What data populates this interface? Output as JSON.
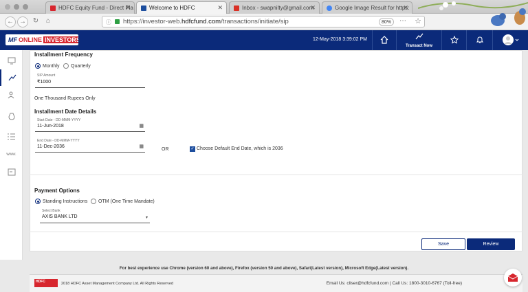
{
  "browser": {
    "tabs": [
      {
        "label": "HDFC Equity Fund - Direct Pla",
        "color": "#d7262e"
      },
      {
        "label": "Welcome to HDFC",
        "color": "#1d4e9e"
      },
      {
        "label": "Inbox - swapnilty@gmail.com",
        "color": "#d93025"
      },
      {
        "label": "Google Image Result for https:",
        "color": "#4285f4"
      }
    ],
    "url_prefix": "https://investor-web.",
    "url_domain": "hdfcfund.com",
    "url_path": "/transactions/initiate/sip",
    "zoom": "80%"
  },
  "header": {
    "logo_mf": "MF",
    "logo_online": "ONLINE",
    "logo_investors": "INVESTORS",
    "datetime": "12-May-2018 3:39:02 PM",
    "transact_label": "Transact Now"
  },
  "sidebar": {
    "www_label": "www."
  },
  "form": {
    "installment_frequency": "Installment Frequency",
    "freq_monthly": "Monthly",
    "freq_quarterly": "Quarterly",
    "sip_amount_label": "SIP Amount",
    "sip_amount_value": "₹1000",
    "amount_in_words": "One Thousand Rupees Only",
    "installment_date_details": "Installment Date Details",
    "start_date_label": "Start Date - DD-MMM-YYYY",
    "start_date_value": "11-Jun-2018",
    "end_date_label": "End Date - DD-MMM-YYYY",
    "end_date_value": "11-Dec-2036",
    "or_label": "OR",
    "default_end_date_label": "Choose Default End Date, which is 2036",
    "payment_options": "Payment Options",
    "pay_standing": "Standing Instructions",
    "pay_otm": "OTM (One Time Mandate)",
    "select_bank_label": "Select Bank",
    "select_bank_value": "AXIS BANK LTD"
  },
  "actions": {
    "save": "Save",
    "review": "Review"
  },
  "notice": "For best experience use Chrome (version 60 and above), Firefox (version 50 and above), Safari(Latest version), Microsoft Edge(Latest version).",
  "footer": {
    "logo_text": "HDFC",
    "copyright": "2018 HDFC Asset Management Company Ltd. All Rights Reserved",
    "contact": "Email Us: cliser@hdfcfund.com | Call Us: 1800-3010-6767 (Toll-free)"
  },
  "colors": {
    "brand": "#0b2a7a",
    "accent": "#d7262e"
  }
}
